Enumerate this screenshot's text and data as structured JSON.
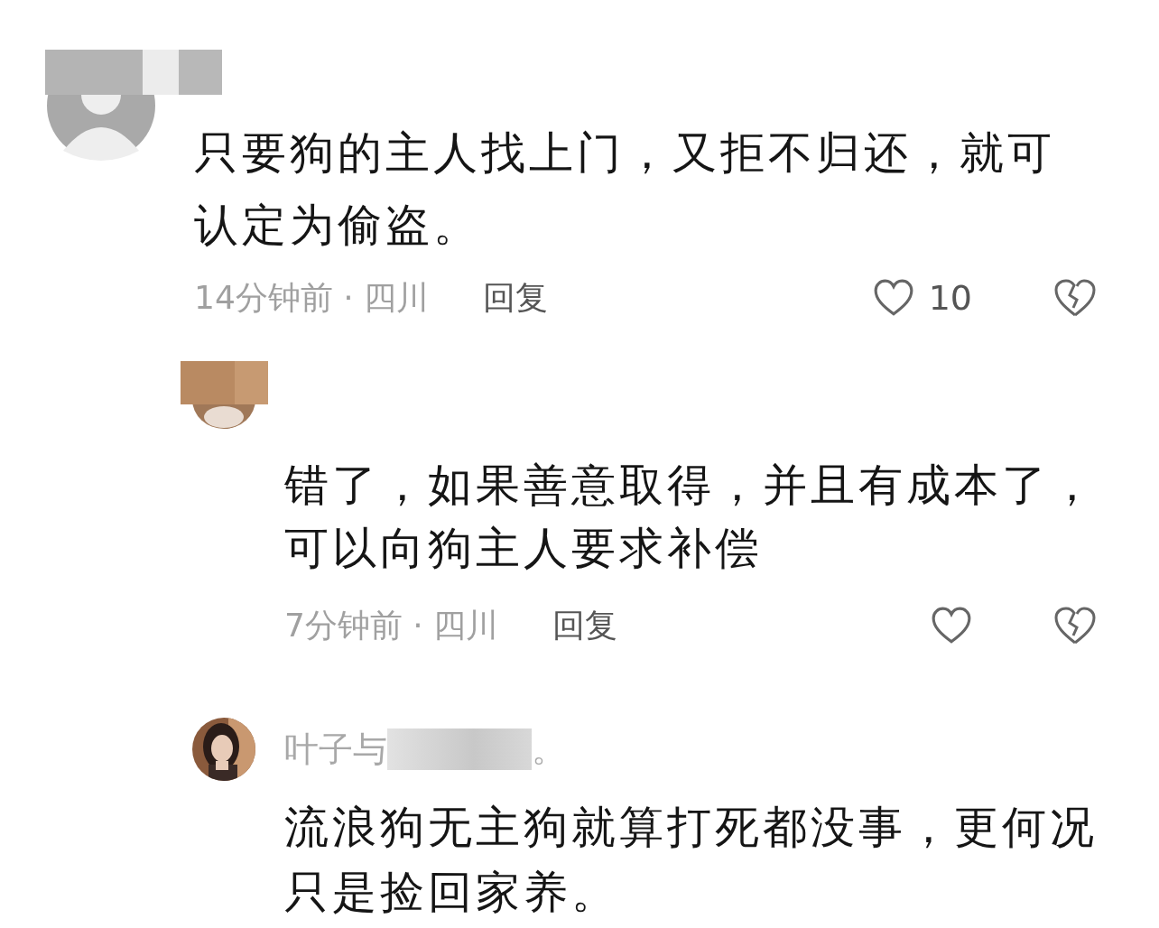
{
  "comments": [
    {
      "avatar": {
        "kind": "default"
      },
      "text": "只要狗的主人找上门，又拒不归还，就可认定为偷盗。",
      "meta": "14分钟前 · 四川",
      "reply_label": "回复",
      "likes": "10",
      "children": [
        {
          "avatar": {
            "kind": "censored"
          },
          "text": "错了，如果善意取得，并且有成本了，可以向狗主人要求补偿",
          "meta": "7分钟前 · 四川",
          "reply_label": "回复"
        },
        {
          "username": "叶子与",
          "username_redacted": true,
          "username_suffix": "。",
          "text": "流浪狗无主狗就算打死都没事，更何况只是捡回家养。"
        }
      ]
    }
  ]
}
